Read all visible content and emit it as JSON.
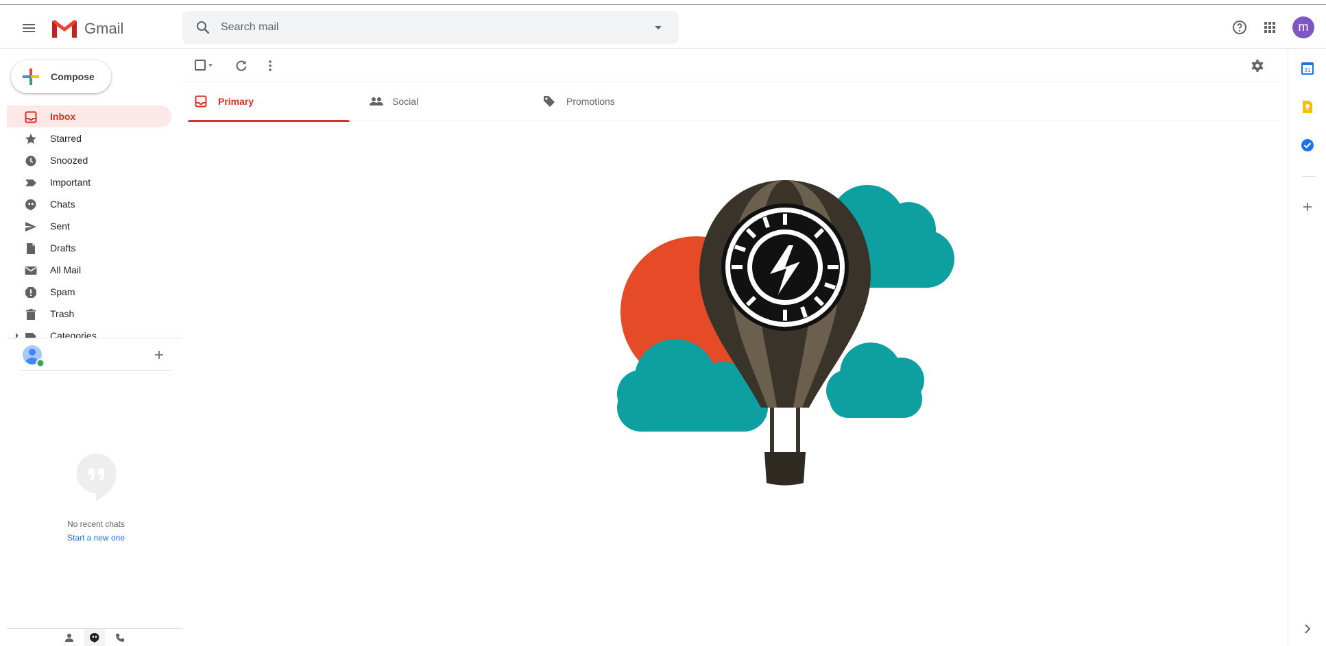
{
  "app": {
    "name": "Gmail"
  },
  "header": {
    "search_placeholder": "Search mail",
    "account_initial": "m",
    "account_color": "#7e57c2"
  },
  "sidebar": {
    "compose_label": "Compose",
    "items": [
      {
        "label": "Inbox",
        "icon": "inbox-icon",
        "active": true
      },
      {
        "label": "Starred",
        "icon": "star-icon"
      },
      {
        "label": "Snoozed",
        "icon": "clock-icon"
      },
      {
        "label": "Important",
        "icon": "important-icon"
      },
      {
        "label": "Chats",
        "icon": "chat-icon"
      },
      {
        "label": "Sent",
        "icon": "send-icon"
      },
      {
        "label": "Drafts",
        "icon": "draft-icon"
      },
      {
        "label": "All Mail",
        "icon": "mail-icon"
      },
      {
        "label": "Spam",
        "icon": "spam-icon"
      },
      {
        "label": "Trash",
        "icon": "trash-icon"
      },
      {
        "label": "Categories",
        "icon": "label-icon"
      }
    ]
  },
  "hangouts": {
    "no_chats": "No recent chats",
    "start_new": "Start a new one"
  },
  "tabs": [
    {
      "label": "Primary",
      "icon": "inbox-icon",
      "active": true
    },
    {
      "label": "Social",
      "icon": "people-icon"
    },
    {
      "label": "Promotions",
      "icon": "tag-icon"
    }
  ],
  "side_panel": {
    "calendar_day": "31"
  },
  "colors": {
    "accent": "#d93025",
    "active_bg": "#fce8e6",
    "link": "#1a73e8"
  }
}
